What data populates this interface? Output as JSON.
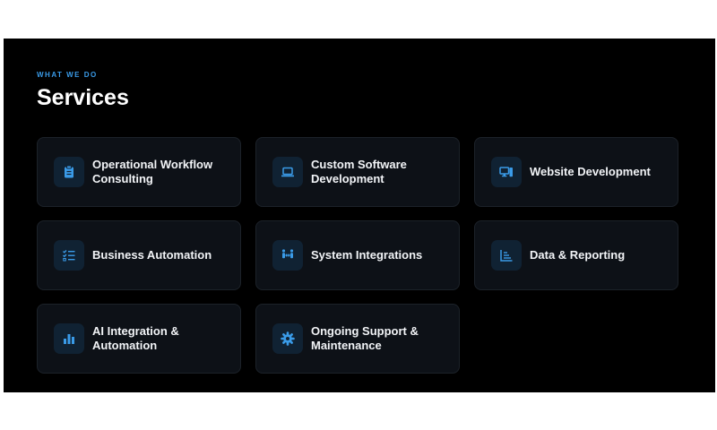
{
  "section": {
    "eyebrow": "WHAT WE DO",
    "title": "Services"
  },
  "services": [
    {
      "label": "Operational Workflow Consulting",
      "icon": "clipboard-icon"
    },
    {
      "label": "Custom Software Development",
      "icon": "laptop-icon"
    },
    {
      "label": "Website Development",
      "icon": "desktop-icon"
    },
    {
      "label": "Business Automation",
      "icon": "checklist-icon"
    },
    {
      "label": "System Integrations",
      "icon": "people-arrows-icon"
    },
    {
      "label": "Data & Reporting",
      "icon": "line-chart-icon"
    },
    {
      "label": "AI Integration & Automation",
      "icon": "bar-chart-icon"
    },
    {
      "label": "Ongoing Support & Maintenance",
      "icon": "gear-icon"
    }
  ],
  "colors": {
    "background": "#000000",
    "card": "#0d1117",
    "icon_tile": "#102233",
    "accent": "#3a9be8",
    "text": "#f2f4f7"
  }
}
